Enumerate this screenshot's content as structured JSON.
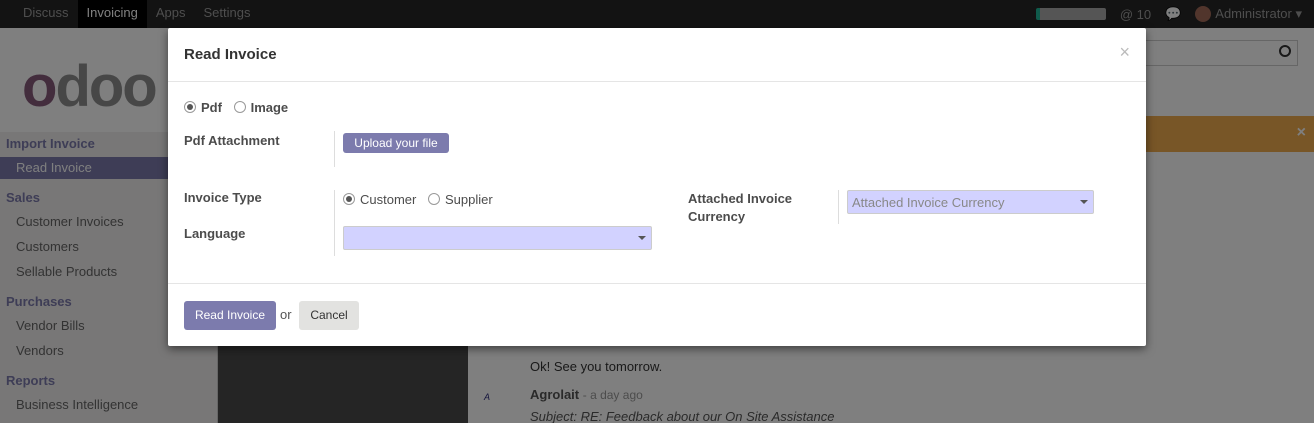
{
  "topbar": {
    "menu": [
      "Discuss",
      "Invoicing",
      "Apps",
      "Settings"
    ],
    "messages_count": "10",
    "user": "Administrator"
  },
  "background": {
    "logo": "odoo",
    "sidebar": {
      "import_invoice": "Import Invoice",
      "read_invoice": "Read Invoice",
      "sales": "Sales",
      "customer_invoices": "Customer Invoices",
      "customers": "Customers",
      "sellable_products": "Sellable Products",
      "purchases": "Purchases",
      "vendor_bills": "Vendor Bills",
      "vendors": "Vendors",
      "reports": "Reports",
      "business_intelligence": "Business Intelligence"
    },
    "chatter": {
      "message1": "Ok! See you tomorrow.",
      "author": "Agrolait",
      "time": "- a day ago",
      "subject": "Subject: RE: Feedback about our On Site Assistance"
    }
  },
  "modal": {
    "title": "Read Invoice",
    "close": "×",
    "source_options": [
      "Pdf",
      "Image"
    ],
    "pdf_attachment_label": "Pdf Attachment",
    "upload_label": "Upload your file",
    "invoice_type_label": "Invoice Type",
    "invoice_type_options": [
      "Customer",
      "Supplier"
    ],
    "language_label": "Language",
    "language_value": "",
    "currency_label_line1": "Attached Invoice",
    "currency_label_line2": "Currency",
    "currency_placeholder": "Attached Invoice Currency",
    "read_button": "Read Invoice",
    "or_text": "or",
    "cancel_button": "Cancel"
  },
  "colors": {
    "brand": "#7c7bad",
    "select_bg": "#d2d2ff",
    "topbar": "#262626"
  }
}
